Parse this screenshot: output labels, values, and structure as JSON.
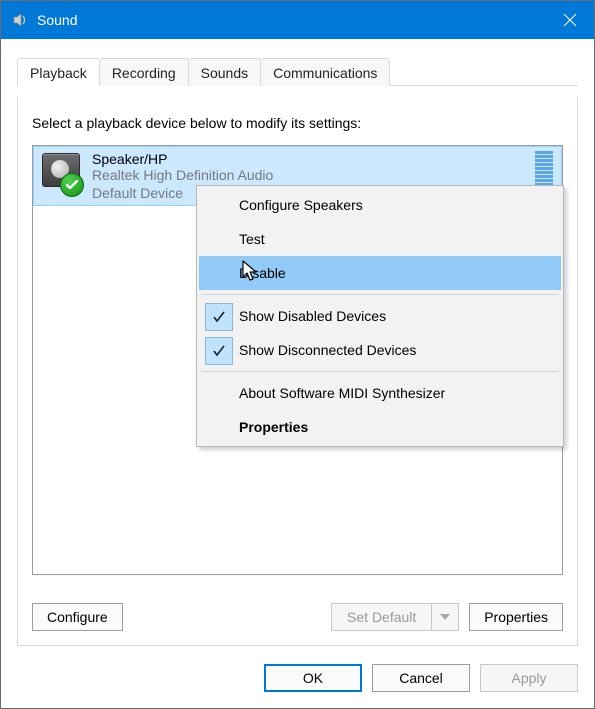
{
  "titlebar": {
    "title": "Sound"
  },
  "tabs": [
    "Playback",
    "Recording",
    "Sounds",
    "Communications"
  ],
  "activeTab": 0,
  "instruction": "Select a playback device below to modify its settings:",
  "device": {
    "name": "Speaker/HP",
    "driver": "Realtek High Definition Audio",
    "status": "Default Device"
  },
  "buttons": {
    "configure": "Configure",
    "setDefault": "Set Default",
    "properties": "Properties",
    "ok": "OK",
    "cancel": "Cancel",
    "apply": "Apply"
  },
  "contextMenu": {
    "configure": "Configure Speakers",
    "test": "Test",
    "disable": "Disable",
    "showDisabled": "Show Disabled Devices",
    "showDisconnected": "Show Disconnected Devices",
    "about": "About Software MIDI Synthesizer",
    "properties": "Properties"
  }
}
